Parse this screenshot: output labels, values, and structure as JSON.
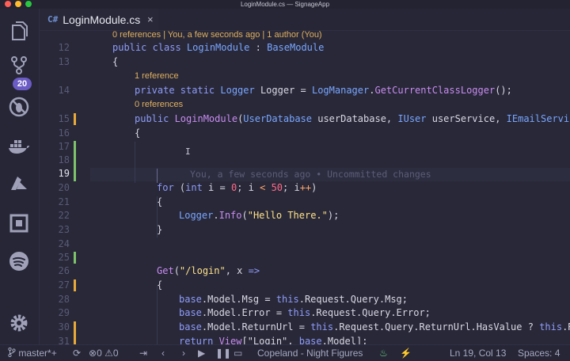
{
  "window": {
    "title": "LoginModule.cs — SignageApp"
  },
  "activity_bar": {
    "items": [
      {
        "name": "explorer-icon"
      },
      {
        "name": "source-control-icon",
        "badge": "20"
      },
      {
        "name": "debug-icon"
      },
      {
        "name": "docker-icon"
      },
      {
        "name": "azure-icon"
      },
      {
        "name": "extensions-icon"
      },
      {
        "name": "spotify-icon"
      },
      {
        "name": "settings-gear-icon"
      }
    ]
  },
  "tab": {
    "lang": "C#",
    "label": "LoginModule.cs",
    "close": "×"
  },
  "editor": {
    "codelens": {
      "top": "0 references | You, a few seconds ago | 1 author (You)",
      "logger": "1 reference",
      "ctor": "0 references"
    },
    "blame": "You, a few seconds ago • Uncommitted changes",
    "line_numbers": [
      "12",
      "13",
      "14",
      "15",
      "16",
      "17",
      "18",
      "19",
      "20",
      "21",
      "22",
      "23",
      "24",
      "25",
      "26",
      "27",
      "28",
      "29",
      "30",
      "31"
    ],
    "lines": {
      "l12": {
        "a": "public class ",
        "b": "LoginModule",
        "c": " : ",
        "d": "BaseModule"
      },
      "l13": "{",
      "l14": {
        "a": "private static ",
        "b": "Logger",
        "c": " Logger = ",
        "d": "LogManager",
        "e": ".",
        "f": "GetCurrentClassLogger",
        "g": "();"
      },
      "l15": {
        "a": "public ",
        "b": "LoginModule",
        "c": "(",
        "d": "UserDatabase",
        "e": " userDatabase, ",
        "f": "IUser",
        "g": " userService, ",
        "h": "IEmailService"
      },
      "l16": "{",
      "l20": {
        "a": "for",
        "b": " (",
        "c": "int",
        "d": " i = ",
        "e": "0",
        "f": "; i ",
        "g": "<",
        "h": " ",
        "i": "50",
        "j": "; i",
        "k": "++",
        "l": ")"
      },
      "l21": "{",
      "l22": {
        "a": "Logger",
        "b": ".",
        "c": "Info",
        "d": "(",
        "e": "\"Hello There.\"",
        "f": ");"
      },
      "l23": "}",
      "l26": {
        "a": "Get",
        "b": "(",
        "c": "\"/login\"",
        "d": ", x ",
        "e": "=>"
      },
      "l27": "{",
      "l28": {
        "a": "base",
        "b": ".Model.Msg = ",
        "c": "this",
        "d": ".Request.Query.Msg;"
      },
      "l29": {
        "a": "base",
        "b": ".Model.Error = ",
        "c": "this",
        "d": ".Request.Query.Error;"
      },
      "l30": {
        "a": "base",
        "b": ".Model.ReturnUrl = ",
        "c": "this",
        "d": ".Request.Query.ReturnUrl.HasValue ? ",
        "e": "this",
        "f": ".Re"
      },
      "l31": {
        "a": "return ",
        "b": "View",
        "c": "[\"Login\", ",
        "d": "base",
        "e": ".Model];"
      }
    }
  },
  "status_bar": {
    "branch": "master*+",
    "errors": "0",
    "warnings": "0",
    "theme": "Copeland - Night Figures",
    "position": "Ln 19, Col 13",
    "spaces": "Spaces: 4"
  },
  "colors": {
    "background": "#282838",
    "keyword": "#8f9cf9",
    "type": "#7aa6ff",
    "function": "#c98cf0",
    "string": "#ffe28a",
    "number": "#ff6b8a",
    "badge": "#6b5bc4",
    "change_added": "#7ec26b",
    "change_modified": "#e8a93a"
  }
}
